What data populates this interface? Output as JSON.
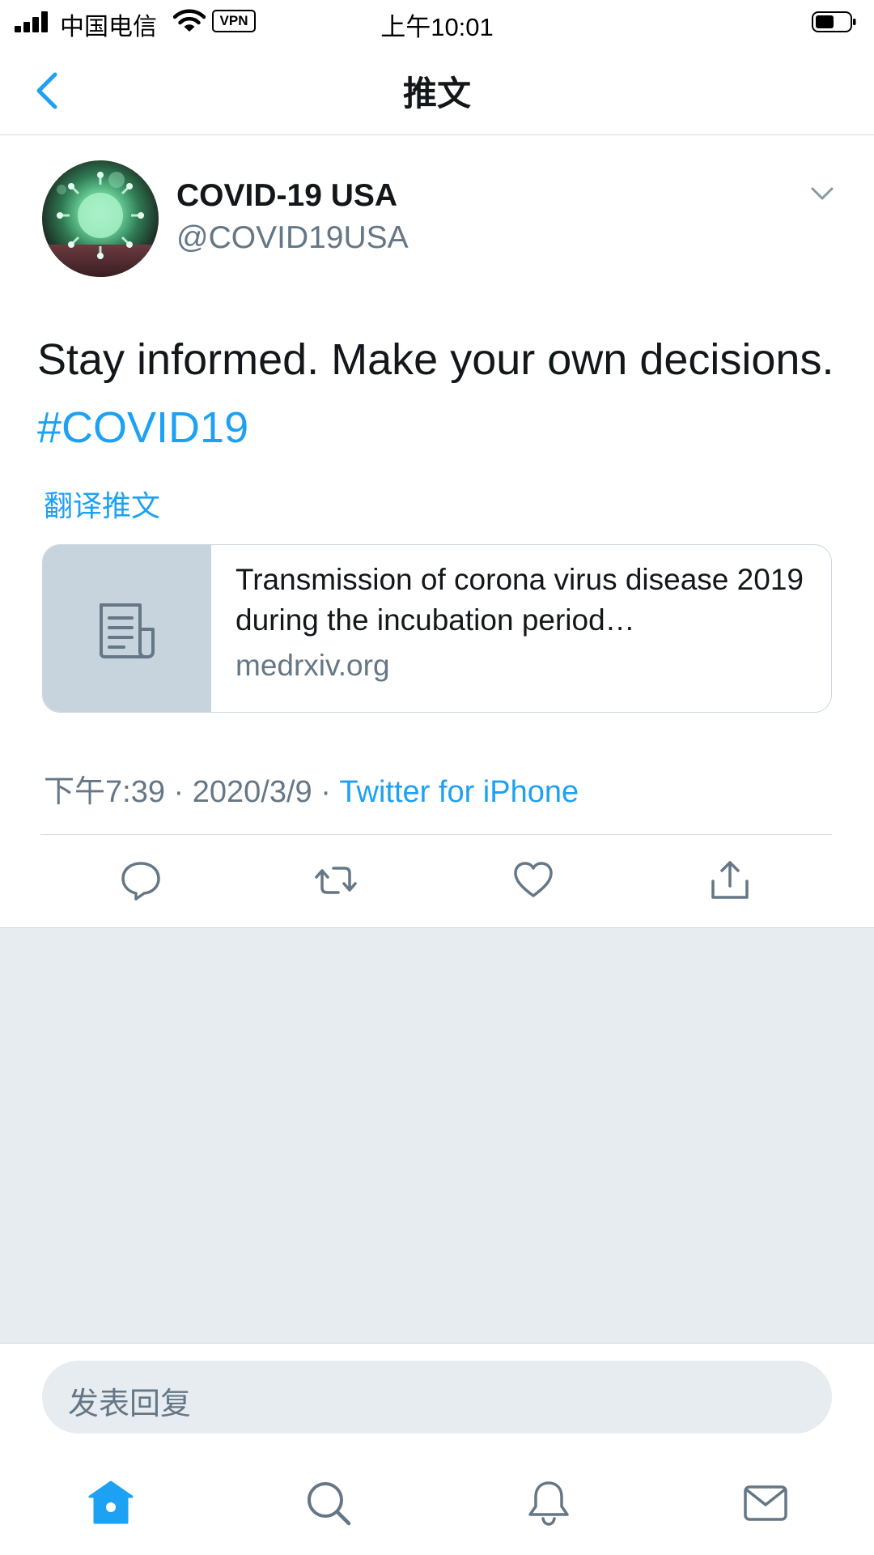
{
  "status_bar": {
    "carrier": "中国电信",
    "vpn": "VPN",
    "time": "上午10:01"
  },
  "nav": {
    "title": "推文",
    "back_icon": "chevron-left-icon"
  },
  "tweet": {
    "display_name": "COVID-19 USA",
    "handle": "@COVID19USA",
    "text_plain": "Stay informed. Make your own decisions. ",
    "hashtag": "#COVID19",
    "translate_label": "翻译推文",
    "card": {
      "title": "Transmission of corona virus disease 2019 during the incubation period…",
      "domain": "medrxiv.org",
      "icon": "document-icon"
    },
    "timestamp": "下午7:39 · 2020/3/9 · ",
    "source": "Twitter for iPhone"
  },
  "actions": [
    {
      "name": "reply-icon"
    },
    {
      "name": "retweet-icon"
    },
    {
      "name": "like-icon"
    },
    {
      "name": "share-icon"
    }
  ],
  "reply": {
    "placeholder": "发表回复"
  },
  "tab_bar": [
    {
      "name": "home-icon",
      "active": true
    },
    {
      "name": "search-icon",
      "active": false
    },
    {
      "name": "notifications-icon",
      "active": false
    },
    {
      "name": "messages-icon",
      "active": false
    }
  ],
  "colors": {
    "accent": "#1da1f2",
    "secondary_text": "#657786",
    "background_gray": "#e6ecf0"
  }
}
